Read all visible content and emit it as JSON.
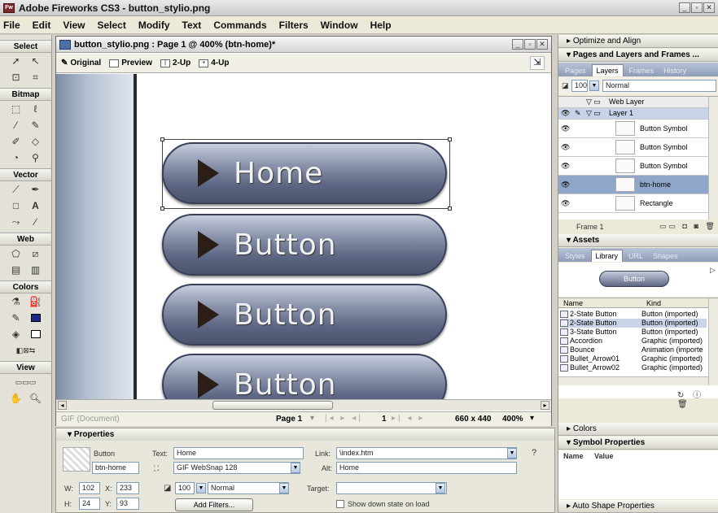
{
  "app": {
    "title": "Adobe Fireworks CS3 - button_stylio.png"
  },
  "menu": [
    "File",
    "Edit",
    "View",
    "Select",
    "Modify",
    "Text",
    "Commands",
    "Filters",
    "Window",
    "Help"
  ],
  "tools": {
    "sections": [
      "Select",
      "Bitmap",
      "Vector",
      "Web",
      "Colors",
      "View"
    ]
  },
  "document": {
    "title": "button_stylio.png : Page 1 @ 400% (btn-home)*",
    "tabs": [
      "Original",
      "Preview",
      "2-Up",
      "4-Up"
    ],
    "buttons": [
      "Home",
      "Button",
      "Button",
      "Button"
    ],
    "status": {
      "format": "GIF (Document)",
      "page": "Page 1",
      "frame": "1",
      "size": "660 x 440",
      "zoom": "400%"
    }
  },
  "properties": {
    "header": "Properties",
    "symbol_type": "Button",
    "instance_name": "btn-home",
    "text_label": "Text:",
    "text_value": "Home",
    "link_label": "Link:",
    "link_value": "\\index.htm",
    "export_value": "GIF WebSnap 128",
    "alt_label": "Alt:",
    "alt_value": "Home",
    "w_label": "W:",
    "w": "102",
    "x_label": "X:",
    "x": "233",
    "h_label": "H:",
    "h": "24",
    "y_label": "Y:",
    "y": "93",
    "opacity": "100",
    "blend": "Normal",
    "target_label": "Target:",
    "target_value": "",
    "add_filters": "Add Filters...",
    "show_down": "Show down state on load"
  },
  "panels": {
    "optimize": "Optimize and Align",
    "pages_layers": "Pages and Layers and Frames ...",
    "pl_tabs": [
      "Pages",
      "Layers",
      "Frames",
      "History"
    ],
    "opacity": "100",
    "blend": "Normal",
    "layers": [
      {
        "name": "Web Layer",
        "kind": "group"
      },
      {
        "name": "Layer 1",
        "kind": "group"
      },
      {
        "name": "Button Symbol",
        "kind": "item"
      },
      {
        "name": "Button Symbol",
        "kind": "item"
      },
      {
        "name": "Button Symbol",
        "kind": "item"
      },
      {
        "name": "btn-home",
        "kind": "item",
        "selected": true
      },
      {
        "name": "Rectangle",
        "kind": "item"
      }
    ],
    "frame": "Frame 1",
    "assets": "Assets",
    "asset_tabs": [
      "Styles",
      "Library",
      "URL",
      "Shapes"
    ],
    "preview_label": "Button",
    "lib_headers": [
      "Name",
      "Kind"
    ],
    "library": [
      {
        "name": "2-State Button",
        "kind": "Button (imported)"
      },
      {
        "name": "2-State Button",
        "kind": "Button (imported)",
        "selected": true
      },
      {
        "name": "3-State Button",
        "kind": "Button (imported)"
      },
      {
        "name": "Accordion",
        "kind": "Graphic (imported)"
      },
      {
        "name": "Bounce",
        "kind": "Animation (importe"
      },
      {
        "name": "Bullet_Arrow01",
        "kind": "Graphic (imported)"
      },
      {
        "name": "Bullet_Arrow02",
        "kind": "Graphic (imported)"
      }
    ],
    "colors": "Colors",
    "symbol_props": "Symbol Properties",
    "sp_headers": [
      "Name",
      "Value"
    ],
    "auto_shape": "Auto Shape Properties"
  }
}
